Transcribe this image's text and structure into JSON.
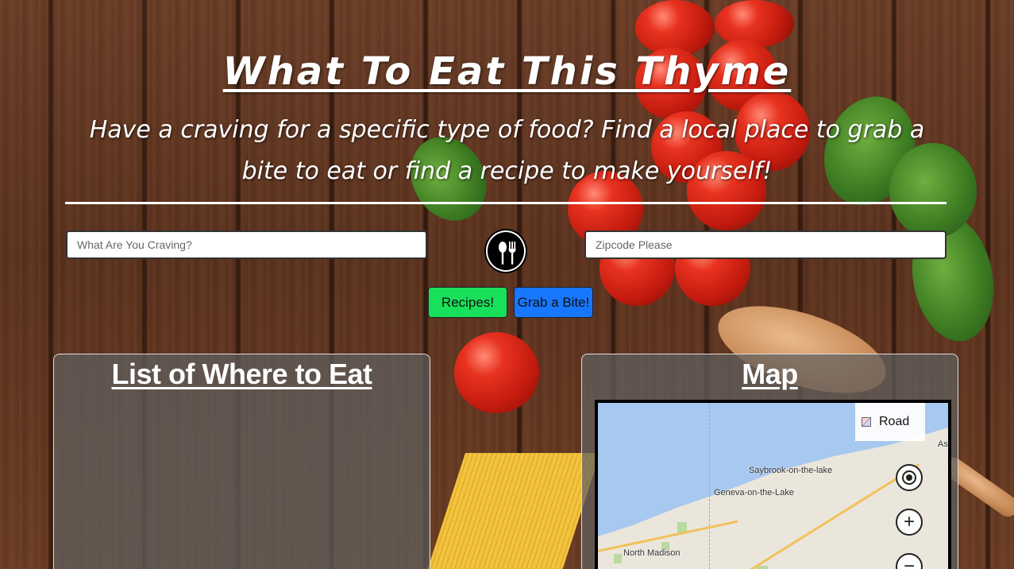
{
  "header": {
    "title": "What To Eat This Thyme",
    "subtitle": "Have a craving for a specific type of food? Find a local place to grab a bite to eat or find a recipe to make yourself!"
  },
  "search": {
    "craving_placeholder": "What Are You Craving?",
    "zipcode_placeholder": "Zipcode Please",
    "logo_icon": "spoon-fork-icon"
  },
  "buttons": {
    "recipes_label": "Recipes!",
    "bite_label": "Grab a Bite!",
    "recipes_color": "#19e05b",
    "bite_color": "#1877ff"
  },
  "panels": {
    "list_title": "List of Where to Eat",
    "map_title": "Map"
  },
  "map": {
    "layer_toggle": "Road",
    "places": [
      "Saybrook-on-the-lake",
      "Geneva-on-the-Lake",
      "North Madison",
      "As"
    ],
    "controls": [
      "locate-icon",
      "zoom-in-icon",
      "zoom-out-icon"
    ],
    "zoom_in_glyph": "+",
    "zoom_out_glyph": "−"
  }
}
